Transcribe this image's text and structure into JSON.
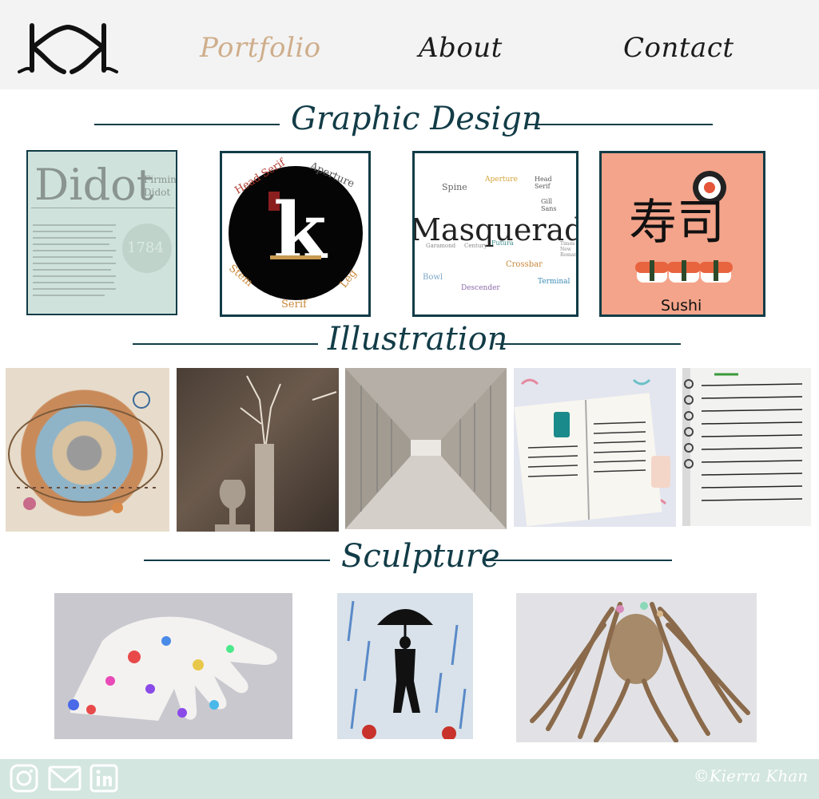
{
  "header": {
    "nav": [
      {
        "label": "Portfolio"
      },
      {
        "label": "About"
      },
      {
        "label": "Contact"
      }
    ]
  },
  "sections": {
    "graphic_design": {
      "title": "Graphic Design",
      "items": {
        "didot": {
          "title": "Didot",
          "sub1": "Firmin",
          "sub2": "Didot",
          "year": "1784"
        },
        "anatomy": {
          "letter": "k",
          "head_serif": "Head Serif",
          "aperture": "Aperture",
          "stem": "Stem",
          "serif": "Serif",
          "leg": "Leg"
        },
        "masquerade": {
          "word": "Masquerad",
          "spine": "Spine",
          "aperture": "Aperture",
          "head_serif": "Head Serif",
          "garamond": "Garamond",
          "century": "Century",
          "futura": "Futura",
          "gill_sans": "Gill Sans",
          "bowl": "Bowl",
          "crossbar": "Crossbar",
          "descender": "Descender",
          "terminal": "Terminal",
          "times_new_roman": "Times New Roman"
        },
        "sushi": {
          "kanji": "寿司",
          "label": "Sushi"
        }
      }
    },
    "illustration": {
      "title": "Illustration"
    },
    "sculpture": {
      "title": "Sculpture"
    }
  },
  "footer": {
    "copyright": "©Kierra Khan"
  },
  "colors": {
    "accent_teal": "#123c47",
    "nav_active": "#cfae8c",
    "header_bg": "#f3f3f3",
    "footer_bg": "#d3e6e0",
    "sushi_bg": "#f4a48a",
    "didot_bg": "#cfe3dc"
  }
}
